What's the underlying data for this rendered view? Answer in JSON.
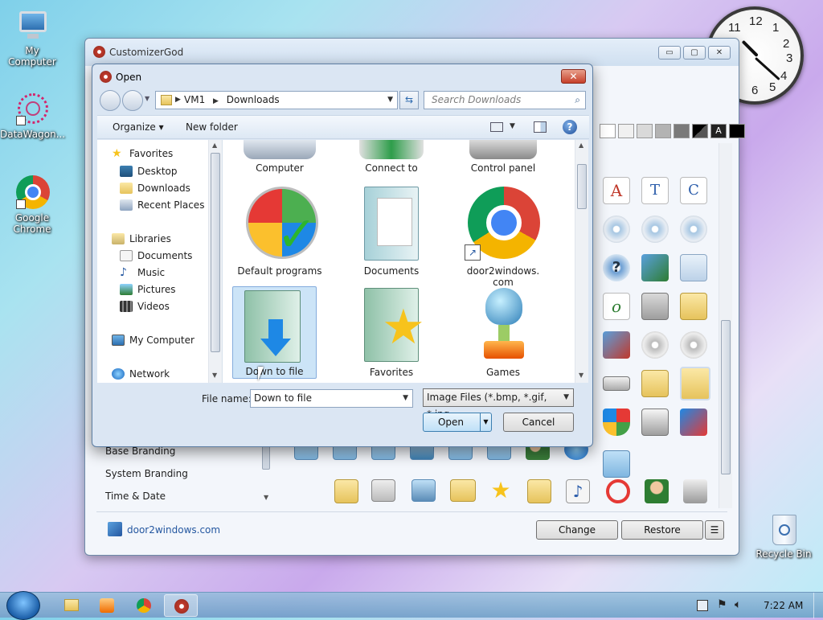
{
  "desktop": {
    "icons": [
      {
        "label": "My Computer",
        "icon": "computer-icon"
      },
      {
        "label": "DataWagon...",
        "icon": "datawagon-icon"
      },
      {
        "label": "Google Chrome",
        "icon": "chrome-icon"
      },
      {
        "label": "Recycle Bin",
        "icon": "recycle-bin-icon"
      }
    ],
    "clock": {
      "numbers": [
        "12",
        "1",
        "2",
        "3",
        "4",
        "5",
        "6",
        "11"
      ]
    }
  },
  "customizer": {
    "title": "CustomizerGod",
    "caption_buttons": {
      "minimize": "▭",
      "maximize": "▢",
      "close": "✕"
    },
    "side_items": [
      "Base Branding",
      "System Branding",
      "Time & Date"
    ],
    "footer_link": "door2windows.com",
    "change_label": "Change",
    "restore_label": "Restore",
    "menu_label": "☰"
  },
  "open_dialog": {
    "title": "Open",
    "close_label": "✕",
    "breadcrumb": [
      "VM1",
      "Downloads"
    ],
    "search_placeholder": "Search Downloads",
    "organize_label": "Organize ▾",
    "new_folder_label": "New folder",
    "nav": {
      "favorites": "Favorites",
      "desktop": "Desktop",
      "downloads": "Downloads",
      "recent": "Recent Places",
      "libraries": "Libraries",
      "documents": "Documents",
      "music": "Music",
      "pictures": "Pictures",
      "videos": "Videos",
      "my_computer": "My Computer",
      "network": "Network"
    },
    "files": [
      {
        "label": "Computer"
      },
      {
        "label": "Connect to"
      },
      {
        "label": "Control panel"
      },
      {
        "label": "Default programs"
      },
      {
        "label": "Documents"
      },
      {
        "label": "door2windows.com"
      },
      {
        "label": "Down to file"
      },
      {
        "label": "Favorites"
      },
      {
        "label": "Games"
      }
    ],
    "filename_label": "File name:",
    "filename_value": "Down to file",
    "filetype_value": "Image Files (*.bmp, *.gif, *.jpg,",
    "open_label": "Open",
    "cancel_label": "Cancel"
  },
  "taskbar": {
    "time": "7:22 AM"
  },
  "colors": {
    "selection": "#cce4f7",
    "accent": "#3c7fb1"
  }
}
